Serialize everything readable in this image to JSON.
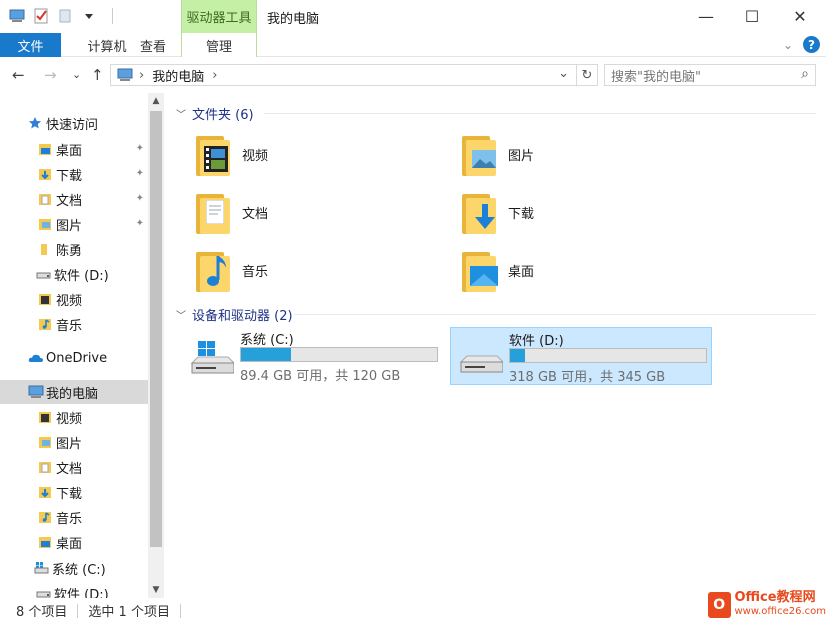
{
  "titlebar": {
    "context_tab": "驱动器工具",
    "title": "我的电脑",
    "minimize": "—",
    "maximize": "☐",
    "close": "✕"
  },
  "ribbon": {
    "tabs": [
      "文件",
      "计算机",
      "查看",
      "管理"
    ],
    "help": "?"
  },
  "navigation": {
    "back": "←",
    "forward": "→",
    "recent": "⌄",
    "up": "↑",
    "address": "我的电脑",
    "address_arrow": "›",
    "dropdown": "⌄",
    "refresh": "↻",
    "search_placeholder": "搜索\"我的电脑\"",
    "search_icon": "⌕"
  },
  "sidebar": {
    "items": [
      {
        "label": "快速访问",
        "icon": "star-icon"
      },
      {
        "label": "桌面",
        "icon": "desktop-folder-icon",
        "pinned": true
      },
      {
        "label": "下载",
        "icon": "downloads-folder-icon",
        "pinned": true
      },
      {
        "label": "文档",
        "icon": "documents-folder-icon",
        "pinned": true
      },
      {
        "label": "图片",
        "icon": "pictures-folder-icon",
        "pinned": true
      },
      {
        "label": "陈勇",
        "icon": "folder-icon"
      },
      {
        "label": "软件 (D:)",
        "icon": "drive-icon"
      },
      {
        "label": "视频",
        "icon": "videos-folder-icon"
      },
      {
        "label": "音乐",
        "icon": "music-folder-icon"
      },
      {
        "label": "OneDrive",
        "icon": "cloud-icon"
      },
      {
        "label": "我的电脑",
        "icon": "computer-icon",
        "selected": true
      },
      {
        "label": "视频",
        "icon": "videos-folder-icon"
      },
      {
        "label": "图片",
        "icon": "pictures-folder-icon"
      },
      {
        "label": "文档",
        "icon": "documents-folder-icon"
      },
      {
        "label": "下载",
        "icon": "downloads-folder-icon"
      },
      {
        "label": "音乐",
        "icon": "music-folder-icon"
      },
      {
        "label": "桌面",
        "icon": "desktop-folder-icon"
      },
      {
        "label": "系统 (C:)",
        "icon": "windows-drive-icon"
      },
      {
        "label": "软件 (D:)",
        "icon": "drive-icon"
      }
    ],
    "pin_glyph": "📌"
  },
  "main": {
    "folders_group": "文件夹 (6)",
    "folders": [
      {
        "label": "视频"
      },
      {
        "label": "图片"
      },
      {
        "label": "文档"
      },
      {
        "label": "下载"
      },
      {
        "label": "音乐"
      },
      {
        "label": "桌面"
      }
    ],
    "drives_group": "设备和驱动器 (2)",
    "drives": [
      {
        "name": "系统 (C:)",
        "info": "89.4 GB 可用，共 120 GB",
        "used_fraction": 0.255
      },
      {
        "name": "软件 (D:)",
        "info": "318 GB 可用，共 345 GB",
        "used_fraction": 0.078,
        "selected": true
      }
    ]
  },
  "statusbar": {
    "count": "8 个项目",
    "selection": "选中 1 个项目"
  },
  "watermark": {
    "logo": "O",
    "title": "Office教程网",
    "url": "www.office26.com"
  },
  "colors": {
    "accent": "#1979ca",
    "context_tab": "#c6efa6",
    "drive_fill": "#26a0da",
    "selection": "#cce8ff"
  }
}
